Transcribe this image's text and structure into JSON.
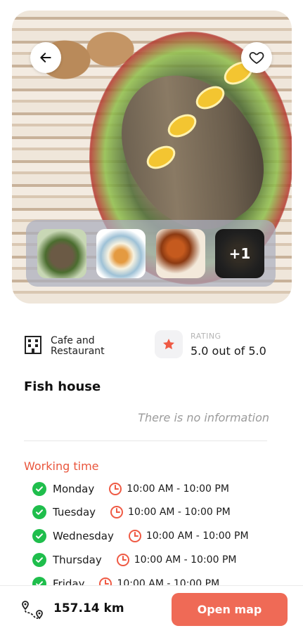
{
  "hero": {
    "thumbnails": [
      {
        "name": "thumb-1"
      },
      {
        "name": "thumb-2"
      },
      {
        "name": "thumb-3"
      },
      {
        "name": "thumb-4",
        "more_label": "+1"
      }
    ]
  },
  "place": {
    "category": "Cafe and Restaurant",
    "rating_caption": "RATING",
    "rating_value": "5.0 out of 5.0",
    "title": "Fish house",
    "description": "There is no information"
  },
  "working_time": {
    "title": "Working time",
    "days": [
      {
        "day": "Monday",
        "hours": "10:00 AM - 10:00 PM"
      },
      {
        "day": "Tuesday",
        "hours": "10:00 AM - 10:00 PM"
      },
      {
        "day": "Wednesday",
        "hours": "10:00 AM - 10:00 PM"
      },
      {
        "day": "Thursday",
        "hours": "10:00 AM - 10:00 PM"
      },
      {
        "day": "Friday",
        "hours": "10:00 AM - 10:00 PM"
      }
    ]
  },
  "bottom": {
    "distance": "157.14 km",
    "open_map_label": "Open map"
  },
  "colors": {
    "accent": "#ef6a56",
    "section_title": "#e9563d",
    "check_green": "#1fbe4c"
  },
  "icons": {
    "back": "arrow-left-icon",
    "favorite": "heart-icon",
    "category": "building-icon",
    "rating": "star-icon",
    "check": "check-circle-icon",
    "clock": "clock-icon",
    "route": "route-icon"
  }
}
